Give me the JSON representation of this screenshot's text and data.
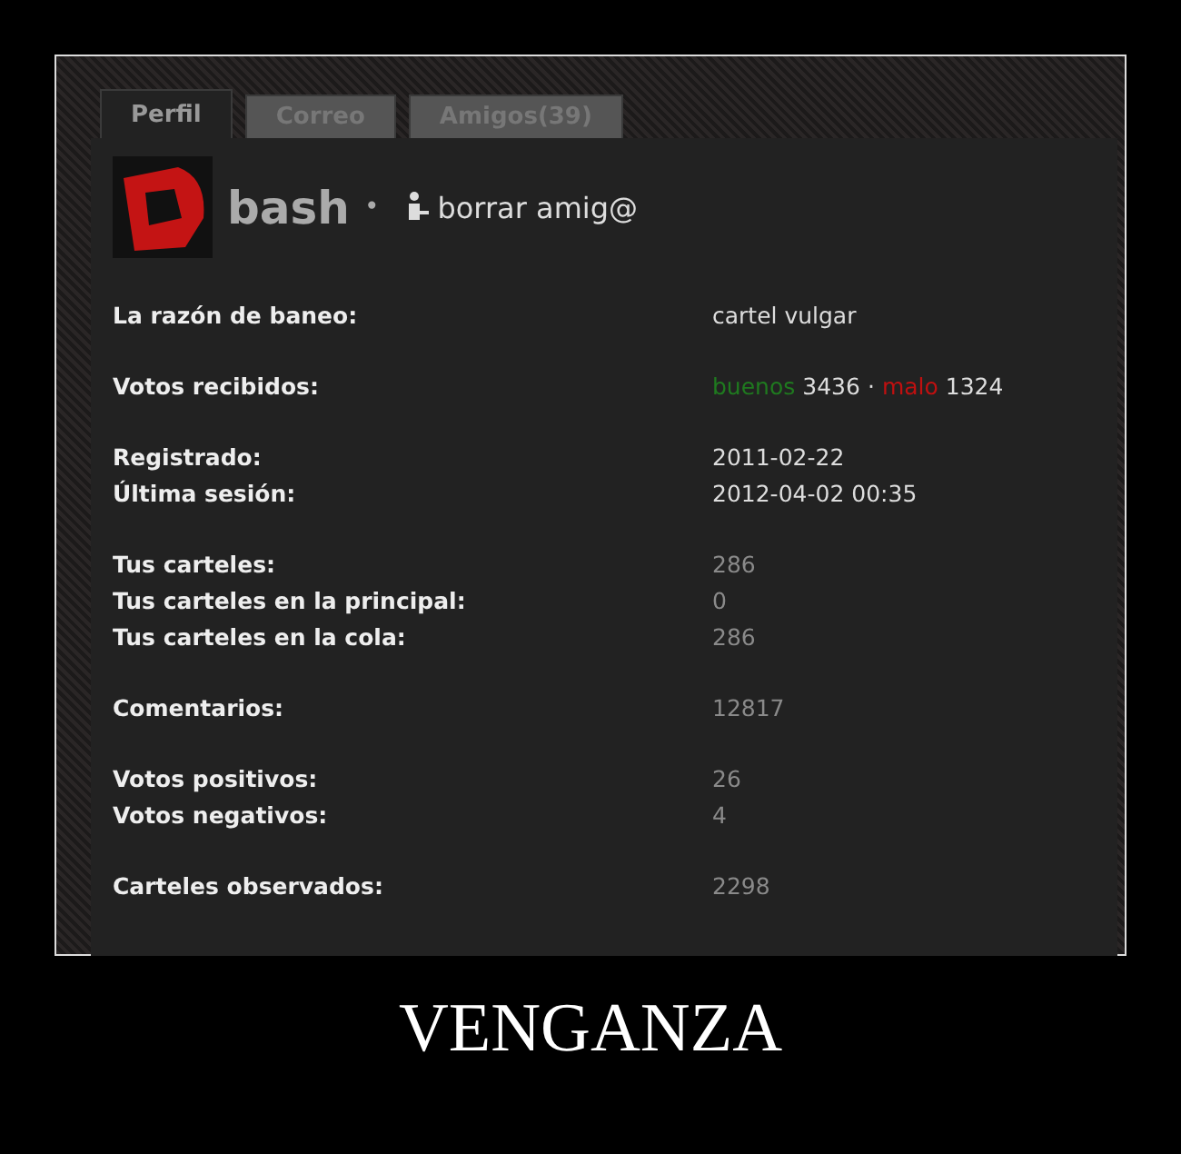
{
  "tabs": [
    {
      "label": "Perfil",
      "selected": true
    },
    {
      "label": "Correo",
      "selected": false
    },
    {
      "label": "Amigos(39)",
      "selected": false
    }
  ],
  "profile": {
    "name": "bash",
    "separator": "•",
    "action": "borrar amig@"
  },
  "groups": [
    {
      "rows": [
        {
          "kind": "text",
          "label": "La razón de baneo:",
          "value": "cartel vulgar",
          "dimmed": false
        }
      ]
    },
    {
      "rows": [
        {
          "kind": "votes",
          "label": "Votos recibidos:",
          "good_label": "buenos",
          "good_count": "3436",
          "separator": "·",
          "bad_label": "malo",
          "bad_count": "1324"
        }
      ]
    },
    {
      "rows": [
        {
          "kind": "text",
          "label": "Registrado:",
          "value": "2011-02-22",
          "dimmed": false
        },
        {
          "kind": "text",
          "label": "Última sesión:",
          "value": "2012-04-02 00:35",
          "dimmed": false
        }
      ]
    },
    {
      "rows": [
        {
          "kind": "text",
          "label": "Tus carteles:",
          "value": "286",
          "dimmed": true
        },
        {
          "kind": "text",
          "label": "Tus carteles en la principal:",
          "value": "0",
          "dimmed": true
        },
        {
          "kind": "text",
          "label": "Tus carteles en la cola:",
          "value": "286",
          "dimmed": true
        }
      ]
    },
    {
      "rows": [
        {
          "kind": "text",
          "label": "Comentarios:",
          "value": "12817",
          "dimmed": true
        }
      ]
    },
    {
      "rows": [
        {
          "kind": "text",
          "label": "Votos positivos:",
          "value": "26",
          "dimmed": true
        },
        {
          "kind": "text",
          "label": "Votos negativos:",
          "value": "4",
          "dimmed": true
        }
      ]
    },
    {
      "rows": [
        {
          "kind": "text",
          "label": "Carteles observados:",
          "value": "2298",
          "dimmed": true
        }
      ]
    }
  ],
  "caption": "VENGANZA"
}
